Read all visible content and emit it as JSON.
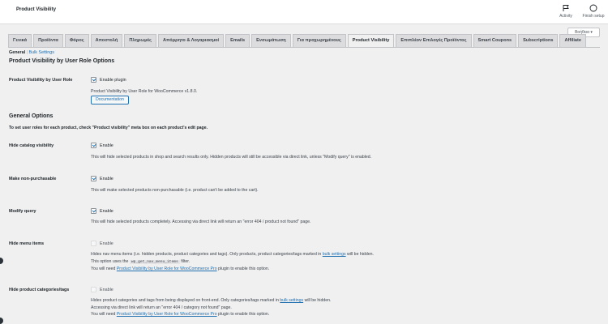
{
  "header": {
    "app_title": "Product Visibility",
    "actions": [
      {
        "label": "Activity",
        "icon": "flag-icon"
      },
      {
        "label": "Finish setup",
        "icon": "circle-progress-icon"
      }
    ],
    "help_label": "Βοήθεια ▾"
  },
  "tabs": [
    "Γενικά",
    "Προϊόντα",
    "Φόρος",
    "Αποστολή",
    "Πληρωμές",
    "Απόρρητο & Λογαριασμοί",
    "Emails",
    "Ενσωμάτωση",
    "Για προχωρημένους",
    "Product Visibility",
    "Επιπλέον Επιλογές Προϊόντος",
    "Smart Coupons",
    "Subscriptions",
    "Affiliate"
  ],
  "active_tab": "Product Visibility",
  "subnav": {
    "current": "General",
    "separator": "|",
    "link": "Bulk Settings"
  },
  "section1": {
    "title": "Product Visibility by User Role Options",
    "row_label": "Product Visibility by User Role",
    "enable_label": "Enable plugin",
    "enable_checked": true,
    "version_text": "Product Visibility by User Role for WooCommerce v1.8.0.",
    "doc_button": "Documentation"
  },
  "section2": {
    "title": "General Options",
    "note": "To set user roles for each product, check \"Product visibility\" meta box on each product's edit page.",
    "rows": [
      {
        "label": "Hide catalog visibility",
        "enable": "Enable",
        "checked": true,
        "desc": "This will hide selected products in shop and search results only. Hidden products will still be accessible via direct link, unless \"Modify query\" is enabled."
      },
      {
        "label": "Make non-purchasable",
        "enable": "Enable",
        "checked": true,
        "desc": "This will make selected products non-purchasable (i.e. product can't be added to the cart)."
      },
      {
        "label": "Modify query",
        "enable": "Enable",
        "checked": true,
        "desc": "This will hide selected products completely. Accessing via direct link will return an \"error 404 / product not found\" page."
      },
      {
        "label": "Hide menu items",
        "enable": "Enable",
        "checked": false,
        "desc1_a": "Hides nav menu items (i.e. hidden products, product categories and tags). Only products, product categories/tags marked in ",
        "desc1_link": "bulk settings",
        "desc1_b": " will be hidden.",
        "desc2_a": "This option uses the ",
        "desc2_code": "wp_get_nav_menu_items",
        "desc2_b": " filter.",
        "desc3_a": "You will need ",
        "desc3_link": "Product Visibility by User Role for WooCommerce Pro",
        "desc3_b": " plugin to enable this option."
      },
      {
        "label": "Hide product categories/tags",
        "enable": "Enable",
        "checked": false,
        "desc1_a": "Hides product categories and tags from being displayed on front-end. Only categories/tags marked in ",
        "desc1_link": "bulk settings",
        "desc1_b": " will be hidden.",
        "desc2": "Accessing via direct link will return an \"error 404 / category not found\" page.",
        "desc3_a": "You will need ",
        "desc3_link": "Product Visibility by User Role for WooCommerce Pro",
        "desc3_b": " plugin to enable this option."
      }
    ]
  },
  "colors": {
    "accent": "#2271b1",
    "background": "#f0f0f1",
    "text": "#1d2327"
  }
}
